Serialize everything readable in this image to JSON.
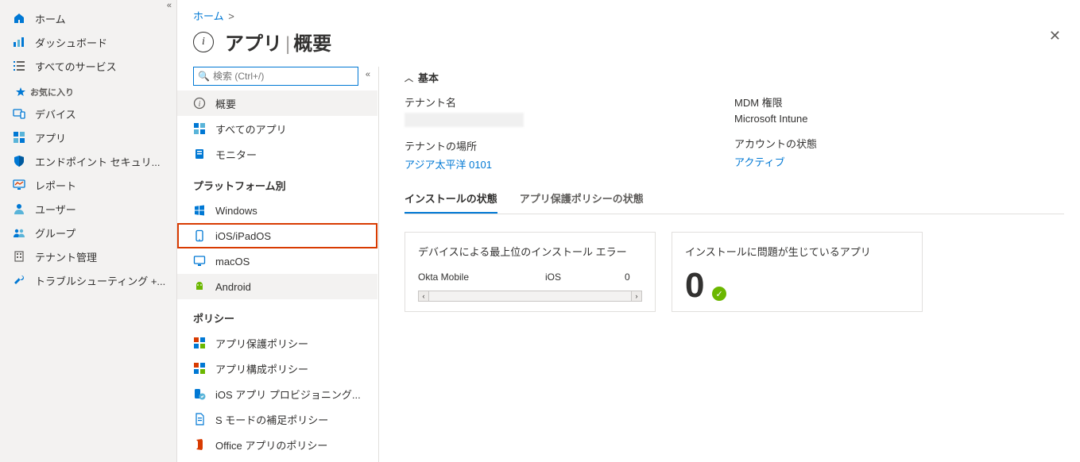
{
  "sidebar": {
    "items": [
      {
        "label": "ホーム"
      },
      {
        "label": "ダッシュボード"
      },
      {
        "label": "すべてのサービス"
      }
    ],
    "fav_heading": "お気に入り",
    "fav_items": [
      {
        "label": "デバイス"
      },
      {
        "label": "アプリ"
      },
      {
        "label": "エンドポイント セキュリ..."
      },
      {
        "label": "レポート"
      },
      {
        "label": "ユーザー"
      },
      {
        "label": "グループ"
      },
      {
        "label": "テナント管理"
      },
      {
        "label": "トラブルシューティング +..."
      }
    ]
  },
  "breadcrumb": {
    "home": "ホーム"
  },
  "title": {
    "main": "アプリ",
    "sub": "概要"
  },
  "search": {
    "placeholder": "検索 (Ctrl+/)"
  },
  "subnav": {
    "top": [
      {
        "label": "概要"
      },
      {
        "label": "すべてのアプリ"
      },
      {
        "label": "モニター"
      }
    ],
    "platform_heading": "プラットフォーム別",
    "platforms": [
      {
        "label": "Windows"
      },
      {
        "label": "iOS/iPadOS"
      },
      {
        "label": "macOS"
      },
      {
        "label": "Android"
      }
    ],
    "policy_heading": "ポリシー",
    "policies": [
      {
        "label": "アプリ保護ポリシー"
      },
      {
        "label": "アプリ構成ポリシー"
      },
      {
        "label": "iOS アプリ プロビジョニング..."
      },
      {
        "label": "S モードの補足ポリシー"
      },
      {
        "label": "Office アプリのポリシー"
      }
    ]
  },
  "main": {
    "section_basic": "基本",
    "tenant_name_label": "テナント名",
    "tenant_loc_label": "テナントの場所",
    "tenant_loc_value": "アジア太平洋 0101",
    "mdm_label": "MDM 権限",
    "mdm_value": "Microsoft Intune",
    "account_status_label": "アカウントの状態",
    "account_status_value": "アクティブ",
    "tabs": [
      {
        "label": "インストールの状態"
      },
      {
        "label": "アプリ保護ポリシーの状態"
      }
    ],
    "card1_title": "デバイスによる最上位のインストール エラー",
    "card1_rows": [
      {
        "name": "Okta Mobile",
        "platform": "iOS",
        "count": "0"
      }
    ],
    "card2_title": "インストールに問題が生じているアプリ",
    "card2_number": "0"
  }
}
